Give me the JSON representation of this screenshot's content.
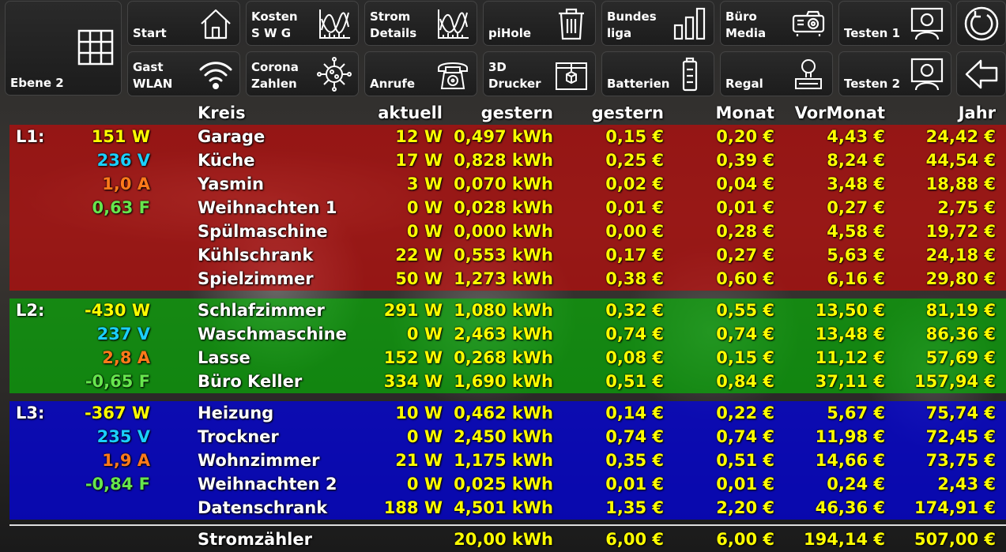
{
  "nav": {
    "ebene": {
      "label": "Ebene 2",
      "icon": "grid-icon"
    },
    "row1": [
      {
        "label": "Start",
        "icon": "home-icon"
      },
      {
        "label": "Kosten\nS W G",
        "icon": "chart-icon"
      },
      {
        "label": "Strom\nDetails",
        "icon": "chart-icon"
      },
      {
        "label": "piHole",
        "icon": "trash-icon"
      },
      {
        "label": "Bundes\nliga",
        "icon": "bar-chart-icon"
      },
      {
        "label": "Büro\nMedia",
        "icon": "projector-icon"
      },
      {
        "label": "Testen 1",
        "icon": "presenter-icon"
      }
    ],
    "row2": [
      {
        "label": "Gast\nWLAN",
        "icon": "wifi-icon"
      },
      {
        "label": "Corona\nZahlen",
        "icon": "virus-icon"
      },
      {
        "label": "Anrufe",
        "icon": "phone-icon"
      },
      {
        "label": "3D\nDrucker",
        "icon": "printer-3d-icon"
      },
      {
        "label": "Batterien",
        "icon": "battery-icon"
      },
      {
        "label": "Regal",
        "icon": "lamp-icon"
      },
      {
        "label": "Testen 2",
        "icon": "presenter-icon"
      }
    ],
    "refresh_icon": "refresh-icon",
    "back_icon": "back-arrow-icon"
  },
  "table": {
    "headers": {
      "kreis": "Kreis",
      "aktuell": "aktuell",
      "gestern_kwh": "gestern",
      "gestern_eur": "gestern",
      "monat": "Monat",
      "vormonat": "VorMonat",
      "jahr": "Jahr"
    },
    "phases": [
      {
        "label": "L1:",
        "power": "151 W",
        "voltage": "236 V",
        "current": "1,0 A",
        "factor": "0,63 F",
        "rows": [
          {
            "name": "Garage",
            "now": "12 W",
            "kwh": "0,497 kWh",
            "eur": "0,15 €",
            "mon": "0,20 €",
            "vmon": "4,43 €",
            "jahr": "24,42 €"
          },
          {
            "name": "Küche",
            "now": "17 W",
            "kwh": "0,828 kWh",
            "eur": "0,25 €",
            "mon": "0,39 €",
            "vmon": "8,24 €",
            "jahr": "44,54 €"
          },
          {
            "name": "Yasmin",
            "now": "3 W",
            "kwh": "0,070 kWh",
            "eur": "0,02 €",
            "mon": "0,04 €",
            "vmon": "3,48 €",
            "jahr": "18,88 €"
          },
          {
            "name": "Weihnachten 1",
            "now": "0 W",
            "kwh": "0,028 kWh",
            "eur": "0,01 €",
            "mon": "0,01 €",
            "vmon": "0,27 €",
            "jahr": "2,75 €"
          },
          {
            "name": "Spülmaschine",
            "now": "0 W",
            "kwh": "0,000 kWh",
            "eur": "0,00 €",
            "mon": "0,28 €",
            "vmon": "4,58 €",
            "jahr": "19,72 €"
          },
          {
            "name": "Kühlschrank",
            "now": "22 W",
            "kwh": "0,553 kWh",
            "eur": "0,17 €",
            "mon": "0,27 €",
            "vmon": "5,63 €",
            "jahr": "24,18 €"
          },
          {
            "name": "Spielzimmer",
            "now": "50 W",
            "kwh": "1,273 kWh",
            "eur": "0,38 €",
            "mon": "0,60 €",
            "vmon": "6,16 €",
            "jahr": "29,80 €"
          }
        ]
      },
      {
        "label": "L2:",
        "power": "-430 W",
        "voltage": "237 V",
        "current": "2,8 A",
        "factor": "-0,65 F",
        "rows": [
          {
            "name": "Schlafzimmer",
            "now": "291 W",
            "kwh": "1,080 kWh",
            "eur": "0,32 €",
            "mon": "0,55 €",
            "vmon": "13,50 €",
            "jahr": "81,19 €"
          },
          {
            "name": "Waschmaschine",
            "now": "0 W",
            "kwh": "2,463 kWh",
            "eur": "0,74 €",
            "mon": "0,74 €",
            "vmon": "13,48 €",
            "jahr": "86,36 €"
          },
          {
            "name": "Lasse",
            "now": "152 W",
            "kwh": "0,268 kWh",
            "eur": "0,08 €",
            "mon": "0,15 €",
            "vmon": "11,12 €",
            "jahr": "57,69 €"
          },
          {
            "name": "Büro Keller",
            "now": "334 W",
            "kwh": "1,690 kWh",
            "eur": "0,51 €",
            "mon": "0,84 €",
            "vmon": "37,11 €",
            "jahr": "157,94 €"
          }
        ]
      },
      {
        "label": "L3:",
        "power": "-367 W",
        "voltage": "235 V",
        "current": "1,9 A",
        "factor": "-0,84 F",
        "rows": [
          {
            "name": "Heizung",
            "now": "10 W",
            "kwh": "0,462 kWh",
            "eur": "0,14 €",
            "mon": "0,22 €",
            "vmon": "5,67 €",
            "jahr": "75,74 €"
          },
          {
            "name": "Trockner",
            "now": "0 W",
            "kwh": "2,450 kWh",
            "eur": "0,74 €",
            "mon": "0,74 €",
            "vmon": "11,98 €",
            "jahr": "72,45 €"
          },
          {
            "name": "Wohnzimmer",
            "now": "21 W",
            "kwh": "1,175 kWh",
            "eur": "0,35 €",
            "mon": "0,51 €",
            "vmon": "14,66 €",
            "jahr": "73,75 €"
          },
          {
            "name": "Weihnachten 2",
            "now": "0 W",
            "kwh": "0,025 kWh",
            "eur": "0,01 €",
            "mon": "0,01 €",
            "vmon": "0,24 €",
            "jahr": "2,43 €"
          },
          {
            "name": "Datenschrank",
            "now": "188 W",
            "kwh": "4,501 kWh",
            "eur": "1,35 €",
            "mon": "2,20 €",
            "vmon": "46,36 €",
            "jahr": "174,91 €"
          }
        ]
      }
    ],
    "total": {
      "name": "Stromzähler",
      "kwh": "20,00 kWh",
      "eur": "6,00 €",
      "mon": "6,00 €",
      "vmon": "194,14 €",
      "jahr": "507,00 €"
    },
    "colors": {
      "value": "#ffff00",
      "power": "#ffff00",
      "voltage": "#1ad0ff",
      "current": "#ff7a1a",
      "factor": "#66e64d",
      "red": "#e60000",
      "green": "#00c800",
      "blue": "#0000eb"
    }
  }
}
